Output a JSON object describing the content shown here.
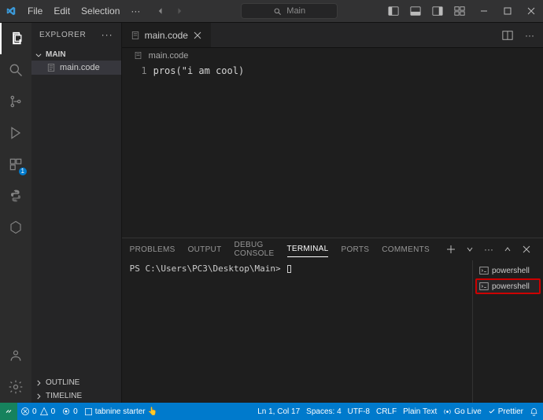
{
  "titlebar": {
    "menus": [
      "File",
      "Edit",
      "Selection"
    ],
    "ellipsis": "···",
    "search_label": "Main"
  },
  "sidebar": {
    "title": "EXPLORER",
    "sections": {
      "main_label": "MAIN",
      "file": "main.code",
      "outline": "OUTLINE",
      "timeline": "TIMELINE"
    }
  },
  "activity": {
    "badge": "1"
  },
  "editor": {
    "tab": "main.code",
    "breadcrumb": "main.code",
    "lineno": "1",
    "line1": "pros(\"i am cool)"
  },
  "panel": {
    "tabs": [
      "PROBLEMS",
      "OUTPUT",
      "DEBUG CONSOLE",
      "TERMINAL",
      "PORTS",
      "COMMENTS"
    ],
    "active": 3,
    "prompt": "PS C:\\Users\\PC3\\Desktop\\Main>",
    "terminals": [
      "powershell",
      "powershell"
    ],
    "highlight": 1
  },
  "status": {
    "errors": "0",
    "warnings": "0",
    "ports": "0",
    "tabnine": "tabnine starter",
    "left_extra": "0",
    "line_col": "Ln 1, Col 17",
    "spaces": "Spaces: 4",
    "encoding": "UTF-8",
    "eol": "CRLF",
    "language": "Plain Text",
    "golive": "Go Live",
    "prettier": "Prettier"
  }
}
